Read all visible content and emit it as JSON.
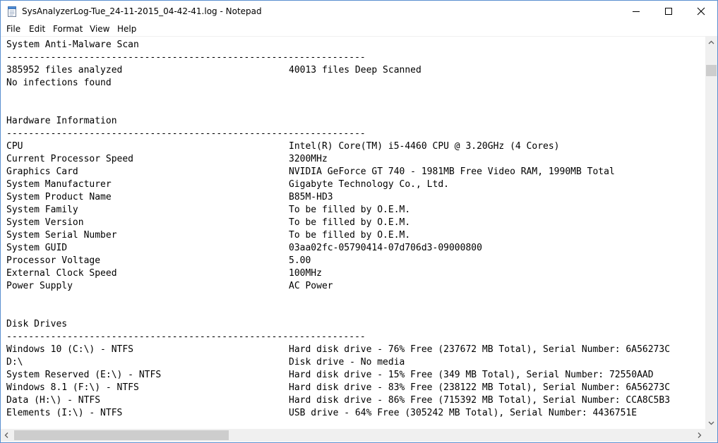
{
  "window": {
    "title": "SysAnalyzerLog-Tue_24-11-2015_04-42-41.log - Notepad"
  },
  "icons": {
    "app": "notepad-icon",
    "minimize": "minimize-icon",
    "maximize": "maximize-icon",
    "close": "close-icon"
  },
  "menu": [
    "File",
    "Edit",
    "Format",
    "View",
    "Help"
  ],
  "lines": [
    {
      "left": "System Anti-Malware Scan",
      "right": ""
    },
    {
      "left": "-----------------------------------------------------------------",
      "right": ""
    },
    {
      "left": "385952 files analyzed",
      "right": "40013 files Deep Scanned"
    },
    {
      "left": "No infections found",
      "right": ""
    },
    {
      "left": "",
      "right": ""
    },
    {
      "left": "",
      "right": ""
    },
    {
      "left": "Hardware Information",
      "right": ""
    },
    {
      "left": "-----------------------------------------------------------------",
      "right": ""
    },
    {
      "left": "CPU",
      "right": "Intel(R) Core(TM) i5-4460 CPU @ 3.20GHz (4 Cores)"
    },
    {
      "left": "Current Processor Speed",
      "right": "3200MHz"
    },
    {
      "left": "Graphics Card",
      "right": "NVIDIA GeForce GT 740 - 1981MB Free Video RAM, 1990MB Total"
    },
    {
      "left": "System Manufacturer",
      "right": "Gigabyte Technology Co., Ltd."
    },
    {
      "left": "System Product Name",
      "right": "B85M-HD3"
    },
    {
      "left": "System Family",
      "right": "To be filled by O.E.M."
    },
    {
      "left": "System Version",
      "right": "To be filled by O.E.M."
    },
    {
      "left": "System Serial Number",
      "right": "To be filled by O.E.M."
    },
    {
      "left": "System GUID",
      "right": "03aa02fc-05790414-07d706d3-09000800"
    },
    {
      "left": "Processor Voltage",
      "right": "5.00"
    },
    {
      "left": "External Clock Speed",
      "right": "100MHz"
    },
    {
      "left": "Power Supply",
      "right": "AC Power"
    },
    {
      "left": "",
      "right": ""
    },
    {
      "left": "",
      "right": ""
    },
    {
      "left": "Disk Drives",
      "right": ""
    },
    {
      "left": "-----------------------------------------------------------------",
      "right": ""
    },
    {
      "left": "Windows 10 (C:\\) - NTFS",
      "right": "Hard disk drive - 76% Free (237672 MB Total), Serial Number: 6A56273C"
    },
    {
      "left": "D:\\",
      "right": "Disk drive - No media"
    },
    {
      "left": "System Reserved (E:\\) - NTFS",
      "right": "Hard disk drive - 15% Free (349 MB Total), Serial Number: 72550AAD"
    },
    {
      "left": "Windows 8.1 (F:\\) - NTFS",
      "right": "Hard disk drive - 83% Free (238122 MB Total), Serial Number: 6A56273C"
    },
    {
      "left": "Data (H:\\) - NTFS",
      "right": "Hard disk drive - 86% Free (715392 MB Total), Serial Number: CCA8C5B3"
    },
    {
      "left": "Elements (I:\\) - NTFS",
      "right": "USB drive - 64% Free (305242 MB Total), Serial Number: 4436751E"
    }
  ]
}
